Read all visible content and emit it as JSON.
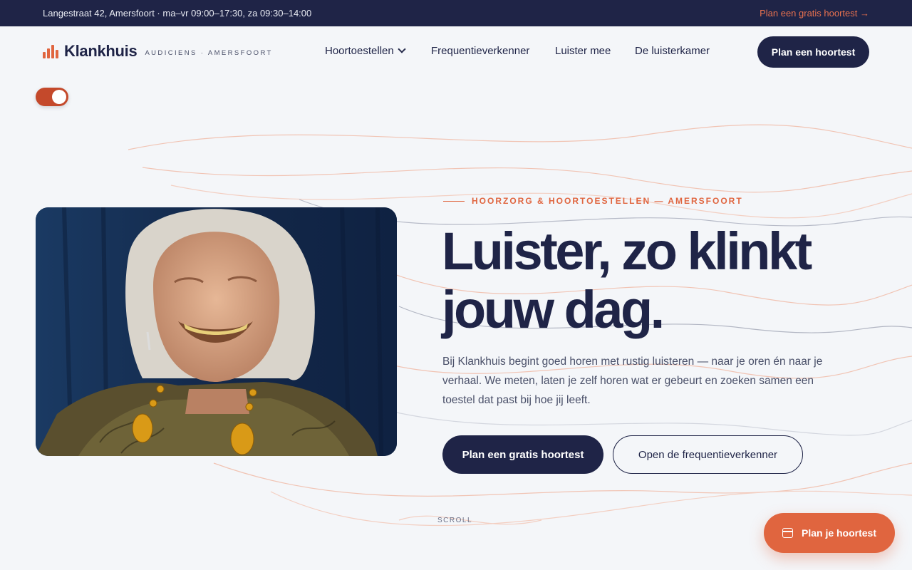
{
  "topbar": {
    "info": "Langestraat 42, Amersfoort · ma–vr 09:00–17:30, za 09:30–14:00",
    "cta": "Plan een gratis hoortest →"
  },
  "header": {
    "logo_name": "Klankhuis",
    "logo_tagline": "AUDICIENS · AMERSFOORT",
    "nav": [
      {
        "label": "Hoortoestellen"
      },
      {
        "label": "Frequentieverkenner"
      },
      {
        "label": "Luister mee"
      },
      {
        "label": "De luisterkamer"
      }
    ],
    "button": "Plan een hoortest"
  },
  "hero": {
    "eyebrow": "HOORZORG & HOORTOESTELLEN — AMERSFOORT",
    "headline_line1": "Luister, zo klinkt",
    "headline_line2": "jouw dag.",
    "lead": "Bij Klankhuis begint goed horen met rustig luisteren — naar je oren én naar je verhaal. We meten, laten je zelf horen wat er gebeurt en zoeken samen een toestel dat past bij hoe jij leeft.",
    "primary_button": "Plan een gratis hoortest",
    "secondary_button": "Open de frequentieverkenner",
    "scroll_label": "SCROLL"
  },
  "floating_cta": {
    "label": "Plan je hoortest",
    "icon": "calendar-icon"
  },
  "toggle": {
    "state": "on"
  },
  "colors": {
    "navy": "#1f2447",
    "accent": "#e0653f",
    "background": "#f4f6f9"
  }
}
